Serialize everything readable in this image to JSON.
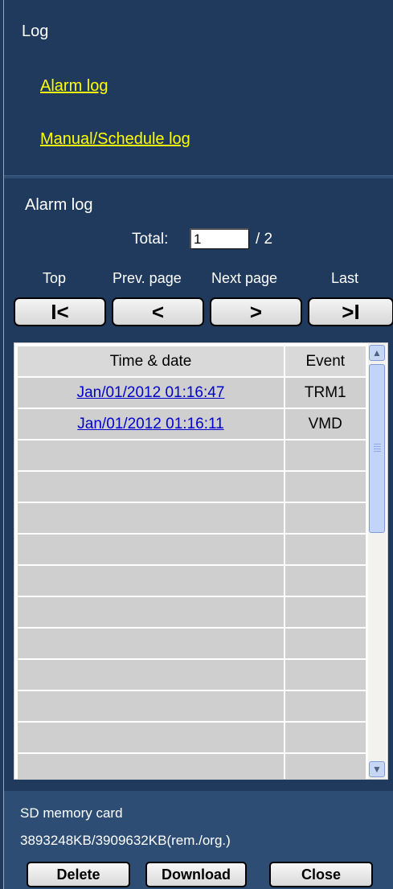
{
  "menu": {
    "heading": "Log",
    "links": [
      "Alarm log",
      "Manual/Schedule log"
    ]
  },
  "alarm": {
    "title": "Alarm log",
    "total_label": "Total:",
    "page_value": "1",
    "page_total": "/ 2",
    "nav_labels": {
      "top": "Top",
      "prev": "Prev. page",
      "next": "Next page",
      "last": "Last"
    },
    "nav_glyphs": {
      "top": "I<",
      "prev": "<",
      "next": ">",
      "last": ">I"
    }
  },
  "table": {
    "headers": {
      "time": "Time & date",
      "event": "Event"
    },
    "rows": [
      {
        "time": "Jan/01/2012 01:16:47",
        "event": "TRM1"
      },
      {
        "time": "Jan/01/2012 01:16:11",
        "event": "VMD"
      }
    ]
  },
  "sd": {
    "title": "SD memory card",
    "capacity": "3893248KB/3909632KB(rem./org.)"
  },
  "buttons": {
    "delete": "Delete",
    "download": "Download",
    "close": "Close"
  },
  "colors": {
    "background": "#1f3a5c",
    "link": "#ffff00",
    "footer": "#2d4d74"
  }
}
